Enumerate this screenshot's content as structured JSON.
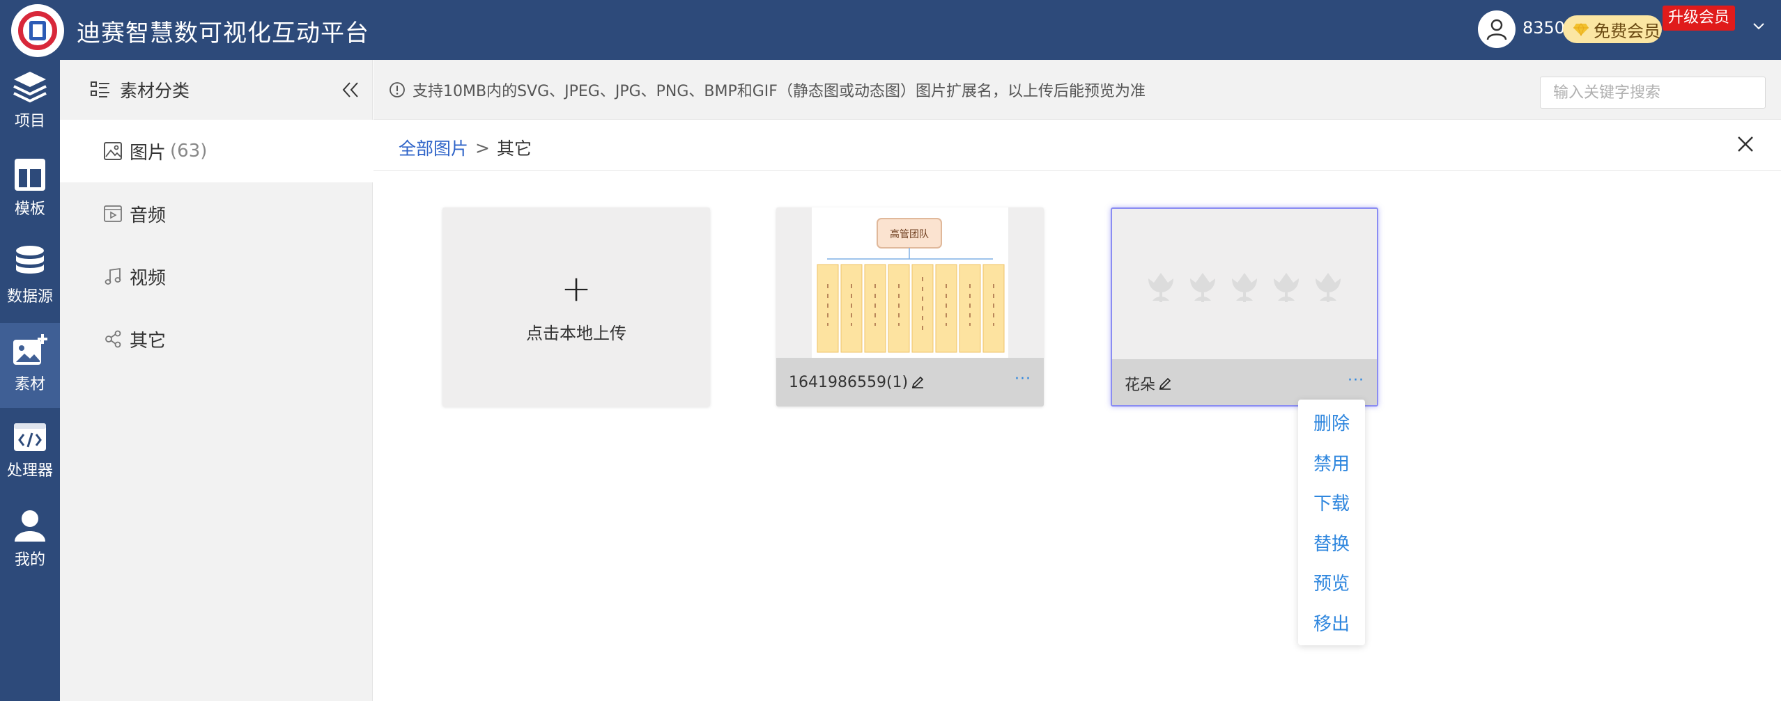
{
  "header": {
    "app_title": "迪赛智慧数可视化互动平台",
    "points": "8350",
    "vip_label": "免费会员",
    "upgrade_label": "升级会员"
  },
  "rail": {
    "items": [
      {
        "label": "项目",
        "icon": "layers-icon"
      },
      {
        "label": "模板",
        "icon": "template-icon"
      },
      {
        "label": "数据源",
        "icon": "database-icon"
      },
      {
        "label": "素材",
        "icon": "image-add-icon",
        "active": true
      },
      {
        "label": "处理器",
        "icon": "code-icon"
      },
      {
        "label": "我的",
        "icon": "user-icon"
      }
    ]
  },
  "category_panel": {
    "title": "素材分类",
    "items": [
      {
        "label": "图片",
        "count": "(63)",
        "icon": "picture-icon",
        "selected": true
      },
      {
        "label": "音频",
        "icon": "audio-icon"
      },
      {
        "label": "视频",
        "icon": "music-note-icon"
      },
      {
        "label": "其它",
        "icon": "share-icon"
      }
    ]
  },
  "notice": {
    "text": "支持10MB内的SVG、JPEG、JPG、PNG、BMP和GIF（静态图或动态图）图片扩展名，以上传后能预览为准"
  },
  "search": {
    "placeholder": "输入关键字搜索",
    "value": ""
  },
  "breadcrumb": {
    "root": "全部图片",
    "separator": ">",
    "current": "其它"
  },
  "cards": {
    "upload": {
      "plus": "+",
      "label": "点击本地上传"
    },
    "items": [
      {
        "name": "1641986559(1)",
        "more": "···",
        "thumb_title": "高管团队"
      },
      {
        "name": "花朵",
        "more": "···"
      }
    ]
  },
  "context_menu": {
    "items": [
      "删除",
      "禁用",
      "下载",
      "替换",
      "预览",
      "移出"
    ]
  },
  "colors": {
    "header_bg": "#2d4a7a",
    "rail_active": "#3f5f95",
    "link_blue": "#2e86de",
    "upgrade_red": "#e01b1b",
    "vip_gold": "#fbe6a3"
  }
}
